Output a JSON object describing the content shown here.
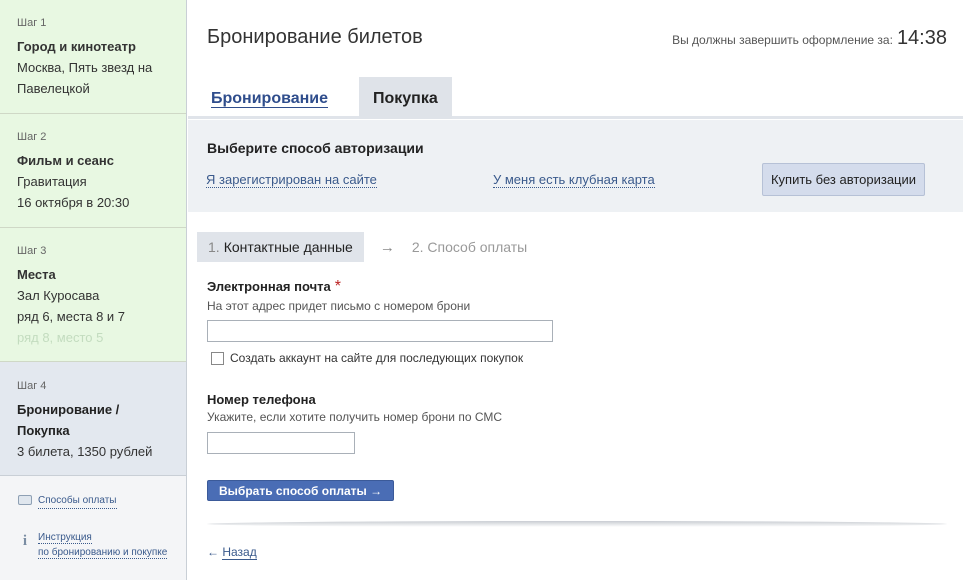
{
  "sidebar": {
    "steps": [
      {
        "num": "Шаг 1",
        "title": "Город и кинотеатр",
        "lines": [
          "Москва, Пять звезд на",
          "Павелецкой"
        ]
      },
      {
        "num": "Шаг 2",
        "title": "Фильм и сеанс",
        "lines": [
          "Гравитация",
          "16 октября в 20:30"
        ]
      },
      {
        "num": "Шаг 3",
        "title": "Места",
        "lines": [
          "Зал Куросава",
          "ряд 6, места 8 и 7",
          "ряд 8, место 5"
        ]
      },
      {
        "num": "Шаг 4",
        "title_line1": "Бронирование /",
        "title_line2": "Покупка",
        "lines": [
          "3 билета, 1350 рублей"
        ]
      }
    ],
    "links": {
      "payment_methods": "Способы оплаты",
      "instructions_line1": "Инструкция",
      "instructions_line2": "по бронированию и покупке"
    }
  },
  "header": {
    "title": "Бронирование билетов",
    "timer_label": "Вы должны завершить оформление за:",
    "timer_value": "14:38"
  },
  "tabs": [
    {
      "label": "Бронирование",
      "active": false
    },
    {
      "label": "Покупка",
      "active": true
    }
  ],
  "auth": {
    "heading": "Выберите способ авторизации",
    "registered_link": "Я зарегистрирован на сайте",
    "club_card_link": "У меня есть клубная карта",
    "no_auth_button": "Купить без авторизации"
  },
  "checkout_steps": {
    "step1_num": "1.",
    "step1_label": "Контактные данные",
    "arrow": "→",
    "step2_label": "2. Способ оплаты"
  },
  "form": {
    "email_label": "Электронная почта",
    "required_mark": "*",
    "email_hint": "На этот адрес придет письмо с номером брони",
    "email_value": "",
    "create_account_label": "Создать аккаунт на сайте для последующих покупок",
    "create_account_checked": false,
    "phone_label": "Номер телефона",
    "phone_hint": "Укажите, если хотите получить номер брони по СМС",
    "phone_value": "",
    "submit_label": "Выбрать способ оплаты →"
  },
  "footer": {
    "back_arrow": "←",
    "back_label": "Назад"
  },
  "colors": {
    "done_step_bg": "#e8f8e2",
    "current_step_bg": "#e3e8ef",
    "accent_button": "#4a6db5",
    "link": "#3a5a8c",
    "required": "#b22222"
  }
}
